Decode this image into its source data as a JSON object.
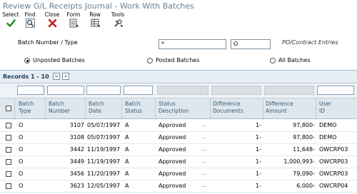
{
  "window": {
    "title": "Review G/L Receipts Journal - Work With Batches"
  },
  "toolbar": {
    "select": "Select",
    "find": "Find",
    "close": "Close",
    "form": "Form",
    "row": "Row",
    "tools": "Tools"
  },
  "form": {
    "batch_label": "Batch Number / Type",
    "batch_number_value": "*",
    "batch_type_value": "O",
    "po_label": "PO/Contract Entries",
    "radios": {
      "unposted": "Unposted Batches",
      "posted": "Posted Batches",
      "all": "All Batches"
    },
    "selected_radio": "unposted"
  },
  "grid": {
    "records_label": "Records 1 - 10",
    "next_btn": ">",
    "last_btn": "»",
    "headers": {
      "batch_type": [
        "Batch",
        "Type"
      ],
      "batch_number": [
        "Batch",
        "Number"
      ],
      "batch_date": [
        "Batch",
        "Date"
      ],
      "batch_status": [
        "Batch",
        "Status"
      ],
      "status_description": [
        "Status",
        "Description"
      ],
      "difference_documents": [
        "Difference",
        "Documents"
      ],
      "difference_amount": [
        "Difference",
        "Amount"
      ],
      "user_id": [
        "User",
        "ID"
      ]
    },
    "rows": [
      {
        "type": "O",
        "number": "3107",
        "date": "05/07/1997",
        "status": "A",
        "desc": "Approved",
        "docs": "1-",
        "amount": "97,800-",
        "user": "DEMO"
      },
      {
        "type": "O",
        "number": "3108",
        "date": "05/07/1997",
        "status": "A",
        "desc": "Approved",
        "docs": "1-",
        "amount": "97,800-",
        "user": "DEMO"
      },
      {
        "type": "O",
        "number": "3442",
        "date": "11/19/1997",
        "status": "A",
        "desc": "Approved",
        "docs": "1-",
        "amount": "11,648-",
        "user": "OWCRP03"
      },
      {
        "type": "O",
        "number": "3449",
        "date": "11/19/1997",
        "status": "A",
        "desc": "Approved",
        "docs": "1-",
        "amount": "1,000,993-",
        "user": "OWCRP03"
      },
      {
        "type": "O",
        "number": "3456",
        "date": "11/20/1997",
        "status": "A",
        "desc": "Approved",
        "docs": "1-",
        "amount": "79,090-",
        "user": "OWCRP03"
      },
      {
        "type": "O",
        "number": "3623",
        "date": "12/05/1997",
        "status": "A",
        "desc": "Approved",
        "docs": "1-",
        "amount": "6,000-",
        "user": "OWCRP04"
      }
    ]
  },
  "colors": {
    "title": "#6a7f8f",
    "grid_header_bg": "#dfe7ee",
    "select_green": "#1a8a1a",
    "close_red": "#cc1f1f"
  }
}
